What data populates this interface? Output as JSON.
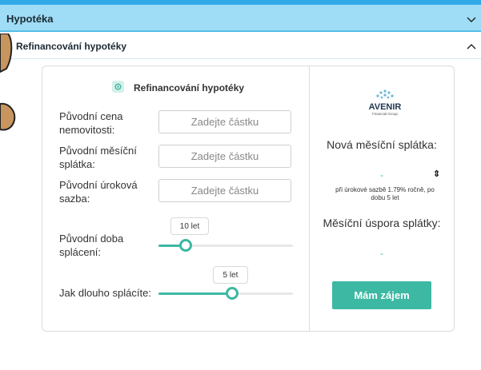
{
  "accordion": {
    "main_label": "Hypotéka",
    "sub_label": "Refinancování hypotéky"
  },
  "calculator": {
    "title": "Refinancování hypotéky",
    "fields": [
      {
        "label": "Původní cena nemovitosti:",
        "placeholder": "Zadejte částku"
      },
      {
        "label": "Původní měsíční splátka:",
        "placeholder": "Zadejte částku"
      },
      {
        "label": "Původní úroková sazba:",
        "placeholder": "Zadejte částku"
      }
    ],
    "sliders": [
      {
        "label": "Původní doba splácení:",
        "value_label": "10 let",
        "fraction": 0.2
      },
      {
        "label": "Jak dlouho splácíte:",
        "value_label": "5 let",
        "fraction": 0.55
      }
    ]
  },
  "result": {
    "logo_text": "AVENIR",
    "logo_sub": "Financial Group",
    "new_payment_label": "Nová měsíční splátka:",
    "new_payment_value": "-",
    "rate_note": "při úrokové sazbě 1.79% ročně, po dobu 5 let",
    "saving_label": "Měsíční úspora splátky:",
    "saving_value": "-",
    "cta_label": "Mám zájem"
  },
  "colors": {
    "accent": "#3db8a3",
    "header_blue": "#9fdcf6",
    "top_blue": "#31a9e6"
  }
}
